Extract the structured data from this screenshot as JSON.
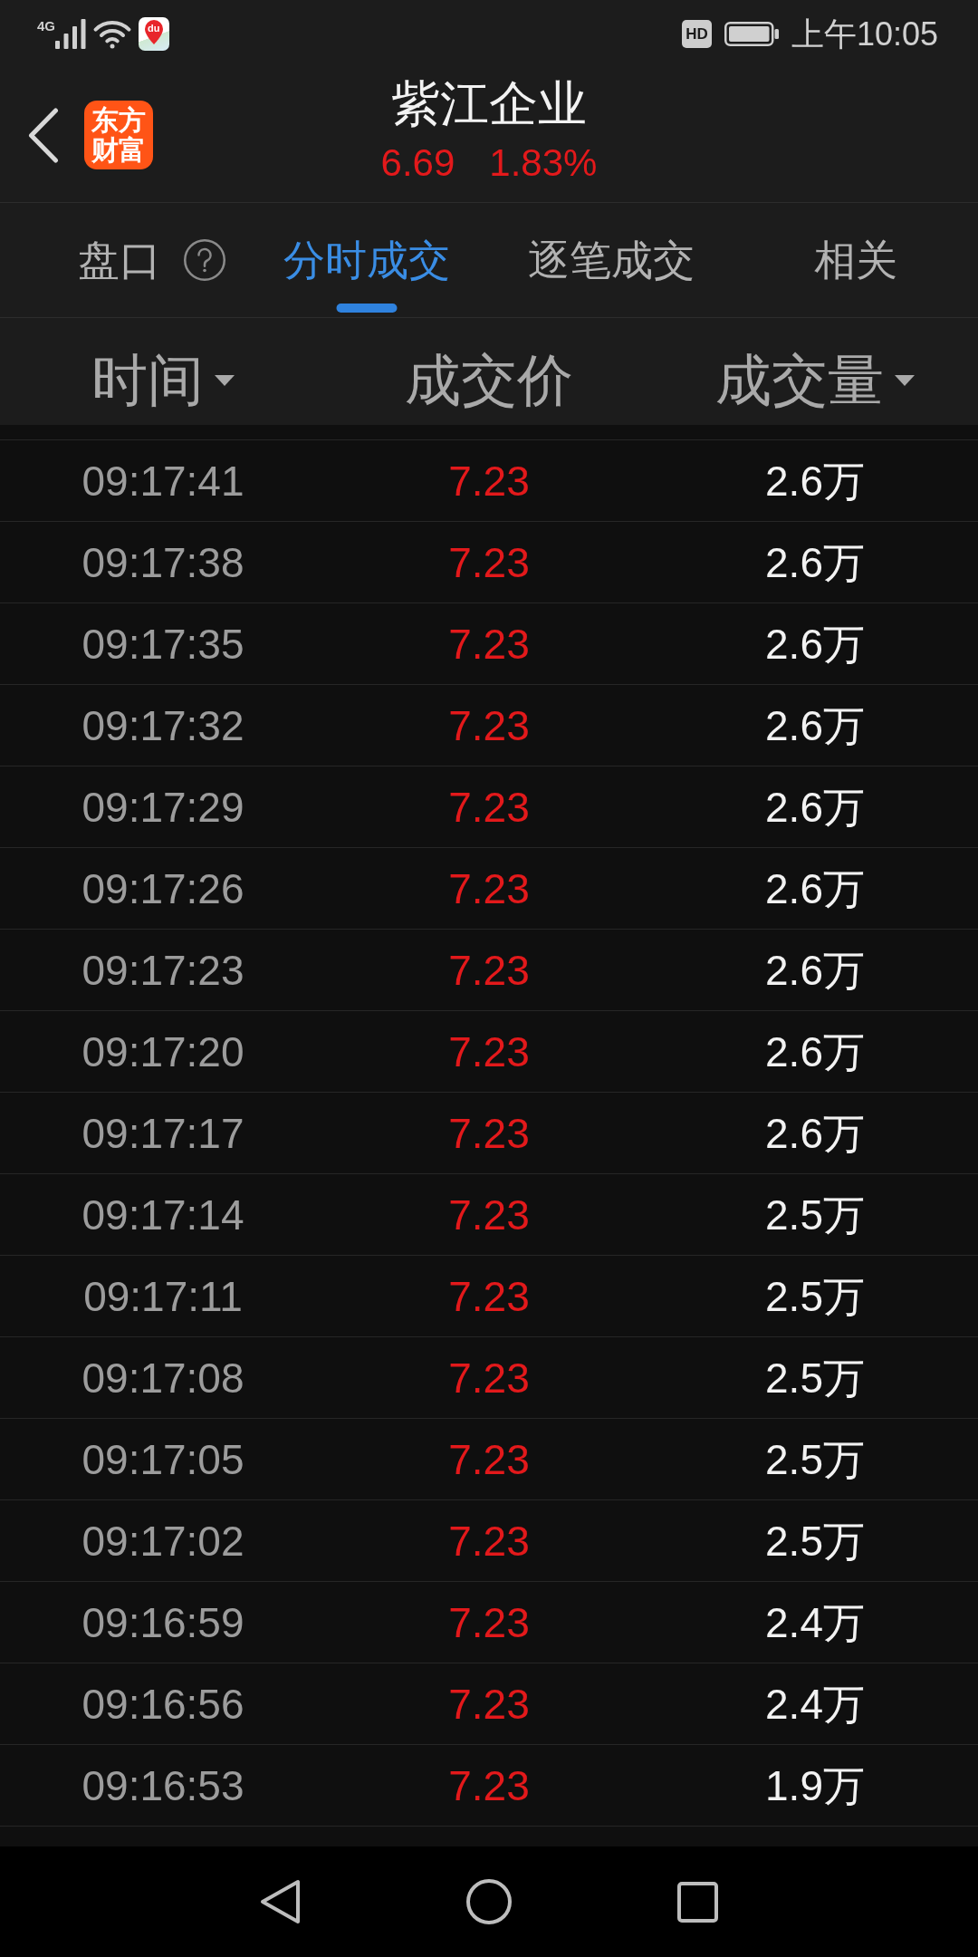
{
  "status_bar": {
    "network": "4G",
    "app_icon_label": "du",
    "hd_badge": "HD",
    "time": "上午10:05"
  },
  "header": {
    "logo": "东方财富",
    "title": "紫江企业",
    "price": "6.69",
    "change": "1.83%",
    "rising": true
  },
  "tabs": [
    {
      "label": "盘口",
      "help_icon": true,
      "selected": false
    },
    {
      "label": "分时成交",
      "help_icon": false,
      "selected": true
    },
    {
      "label": "逐笔成交",
      "help_icon": false,
      "selected": false
    },
    {
      "label": "相关",
      "help_icon": false,
      "selected": false
    }
  ],
  "table": {
    "columns": [
      {
        "label": "时间",
        "sortable": true
      },
      {
        "label": "成交价",
        "sortable": false
      },
      {
        "label": "成交量",
        "sortable": true
      }
    ],
    "rows": [
      {
        "time": "09:17:41",
        "price": "7.23",
        "volume": "2.6万",
        "rising": true
      },
      {
        "time": "09:17:38",
        "price": "7.23",
        "volume": "2.6万",
        "rising": true
      },
      {
        "time": "09:17:35",
        "price": "7.23",
        "volume": "2.6万",
        "rising": true
      },
      {
        "time": "09:17:32",
        "price": "7.23",
        "volume": "2.6万",
        "rising": true
      },
      {
        "time": "09:17:29",
        "price": "7.23",
        "volume": "2.6万",
        "rising": true
      },
      {
        "time": "09:17:26",
        "price": "7.23",
        "volume": "2.6万",
        "rising": true
      },
      {
        "time": "09:17:23",
        "price": "7.23",
        "volume": "2.6万",
        "rising": true
      },
      {
        "time": "09:17:20",
        "price": "7.23",
        "volume": "2.6万",
        "rising": true
      },
      {
        "time": "09:17:17",
        "price": "7.23",
        "volume": "2.6万",
        "rising": true
      },
      {
        "time": "09:17:14",
        "price": "7.23",
        "volume": "2.5万",
        "rising": true
      },
      {
        "time": "09:17:11",
        "price": "7.23",
        "volume": "2.5万",
        "rising": true
      },
      {
        "time": "09:17:08",
        "price": "7.23",
        "volume": "2.5万",
        "rising": true
      },
      {
        "time": "09:17:05",
        "price": "7.23",
        "volume": "2.5万",
        "rising": true
      },
      {
        "time": "09:17:02",
        "price": "7.23",
        "volume": "2.5万",
        "rising": true
      },
      {
        "time": "09:16:59",
        "price": "7.23",
        "volume": "2.4万",
        "rising": true
      },
      {
        "time": "09:16:56",
        "price": "7.23",
        "volume": "2.4万",
        "rising": true
      },
      {
        "time": "09:16:53",
        "price": "7.23",
        "volume": "1.9万",
        "rising": true
      }
    ]
  }
}
